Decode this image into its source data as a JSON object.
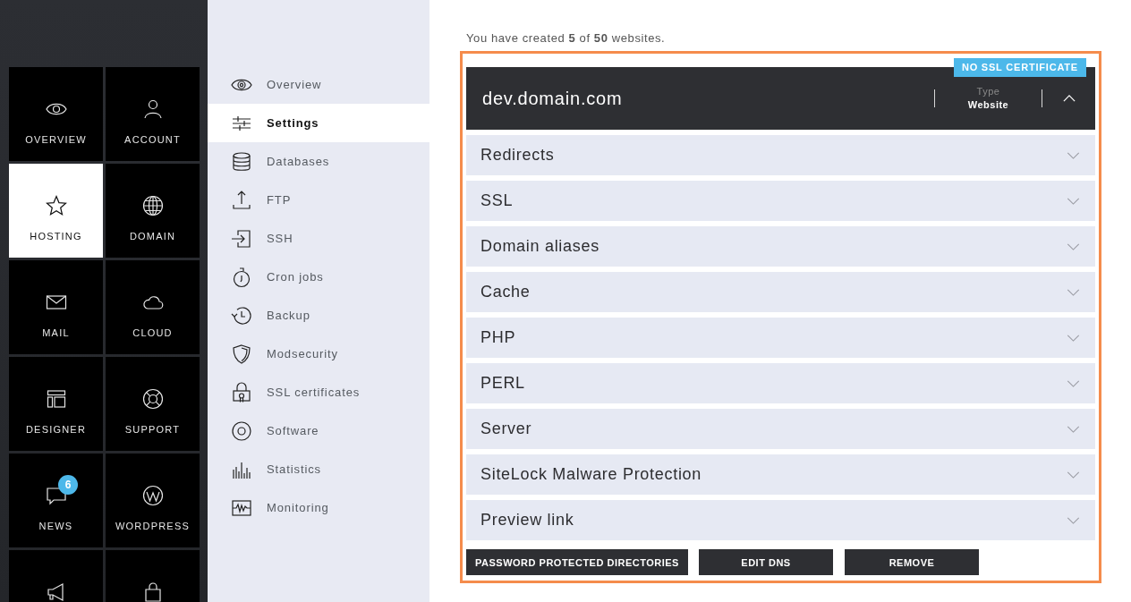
{
  "tiles": [
    {
      "label": "OVERVIEW",
      "selected": false
    },
    {
      "label": "ACCOUNT",
      "selected": false
    },
    {
      "label": "HOSTING",
      "selected": true
    },
    {
      "label": "DOMAIN",
      "selected": false
    },
    {
      "label": "MAIL",
      "selected": false
    },
    {
      "label": "CLOUD",
      "selected": false
    },
    {
      "label": "DESIGNER",
      "selected": false
    },
    {
      "label": "SUPPORT",
      "selected": false
    },
    {
      "label": "NEWS",
      "selected": false,
      "badge": "6"
    },
    {
      "label": "WORDPRESS",
      "selected": false
    },
    {
      "selected": false
    },
    {
      "selected": false
    }
  ],
  "submenu": [
    {
      "label": "Overview",
      "selected": false
    },
    {
      "label": "Settings",
      "selected": true
    },
    {
      "label": "Databases",
      "selected": false
    },
    {
      "label": "FTP",
      "selected": false
    },
    {
      "label": "SSH",
      "selected": false
    },
    {
      "label": "Cron jobs",
      "selected": false
    },
    {
      "label": "Backup",
      "selected": false
    },
    {
      "label": "Modsecurity",
      "selected": false
    },
    {
      "label": "SSL certificates",
      "selected": false
    },
    {
      "label": "Software",
      "selected": false
    },
    {
      "label": "Statistics",
      "selected": false
    },
    {
      "label": "Monitoring",
      "selected": false
    }
  ],
  "intro": "You have created **5** of **50** websites.",
  "site": {
    "badge": "NO SSL CERTIFICATE",
    "domain": "dev.domain.com",
    "type_label": "Type",
    "type_value": "Website",
    "expanded": true
  },
  "sections": [
    {
      "title": "Redirects",
      "expanded": false
    },
    {
      "title": "SSL",
      "expanded": false
    },
    {
      "title": "Domain aliases",
      "expanded": false
    },
    {
      "title": "Cache",
      "expanded": false
    },
    {
      "title": "PHP",
      "expanded": false
    },
    {
      "title": "PERL",
      "expanded": false
    },
    {
      "title": "Server",
      "expanded": false
    },
    {
      "title": "SiteLock Malware Protection",
      "expanded": false
    },
    {
      "title": "Preview link",
      "expanded": false
    }
  ],
  "buttons": [
    "PASSWORD PROTECTED DIRECTORIES",
    "EDIT DNS",
    "REMOVE"
  ]
}
